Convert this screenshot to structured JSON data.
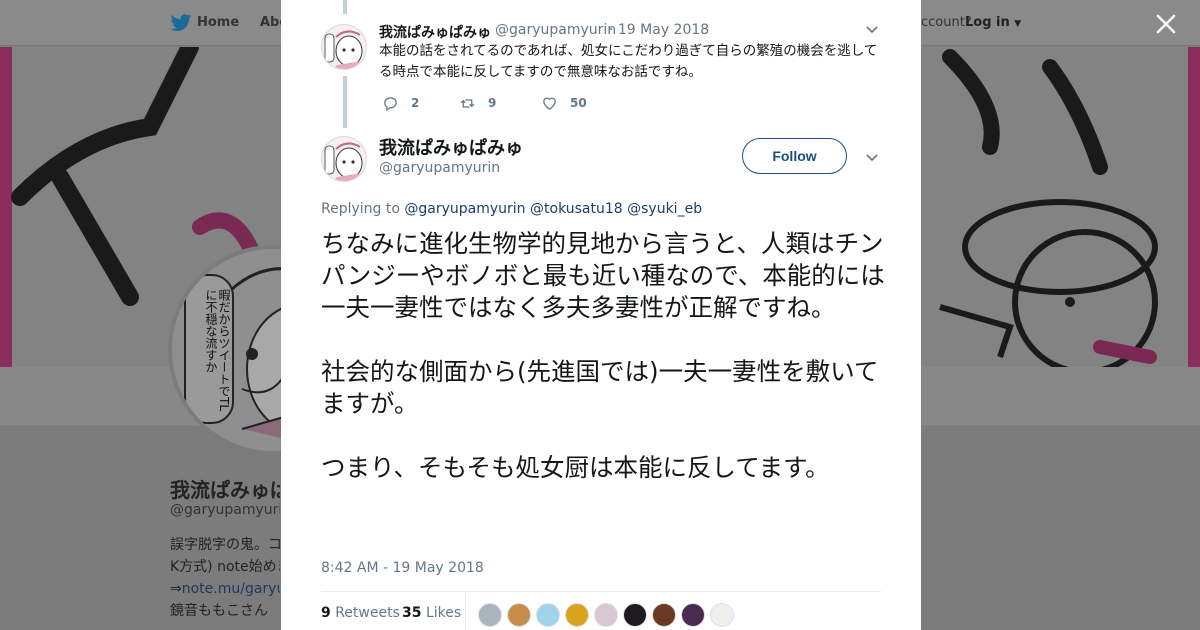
{
  "background": {
    "nav": {
      "home": "Home",
      "about": "Abo",
      "account_prompt": "ccount?",
      "login": "Log in"
    },
    "banner_text": "ダ",
    "avatar_speech": "暇だからツイートでTLに不穏な流すか",
    "profile": {
      "name": "我流ぱみゅぱみゅ",
      "handle": "@garyupamyurin",
      "bio_line1": "誤字脱字の鬼。コ",
      "bio_line2": "K方式) note始めま",
      "bio_link_prefix": "⇒",
      "bio_link": "note.mu/garyup",
      "bio_line4": "鏡音ももこさん"
    }
  },
  "prev_tweet": {
    "name": "我流ぱみゅぱみゅ",
    "handle": "@garyupamyurin",
    "date": "· 19 May 2018",
    "text": "本能の話をされてるのであれば、処女にこだわり過ぎて自らの繁殖の機会を逃してる時点で本能に反してますので無意味なお話ですね。",
    "replies": "2",
    "retweets": "9",
    "likes": "50"
  },
  "main_tweet": {
    "name": "我流ぱみゅぱみゅ",
    "handle": "@garyupamyurin",
    "follow_label": "Follow",
    "replying_label": "Replying to",
    "mentions": [
      "@garyupamyurin",
      "@tokusatu18",
      "@syuki_eb"
    ],
    "text": "ちなみに進化生物学的見地から言うと、人類はチンパンジーやボノボと最も近い種なので、本能的には一夫一妻性ではなく多夫多妻性が正解ですね。\n\n社会的な側面から(先進国では)一夫一妻性を敷いてますが。\n\nつまり、そもそも処女厨は本能に反してます。",
    "timestamp": "8:42 AM - 19 May 2018",
    "retweet_count": "9",
    "retweet_label": "Retweets",
    "like_count": "35",
    "like_label": "Likes"
  },
  "colors": {
    "accent": "#1c4f80",
    "twitter_blue": "#1da1f2",
    "muted": "#657786",
    "banner_pink": "#8a2d5a"
  },
  "icons": {
    "logo": "twitter-bird-icon",
    "close": "close-icon",
    "caret": "chevron-down-icon",
    "reply": "reply-icon",
    "retweet": "retweet-icon",
    "like": "heart-icon"
  }
}
